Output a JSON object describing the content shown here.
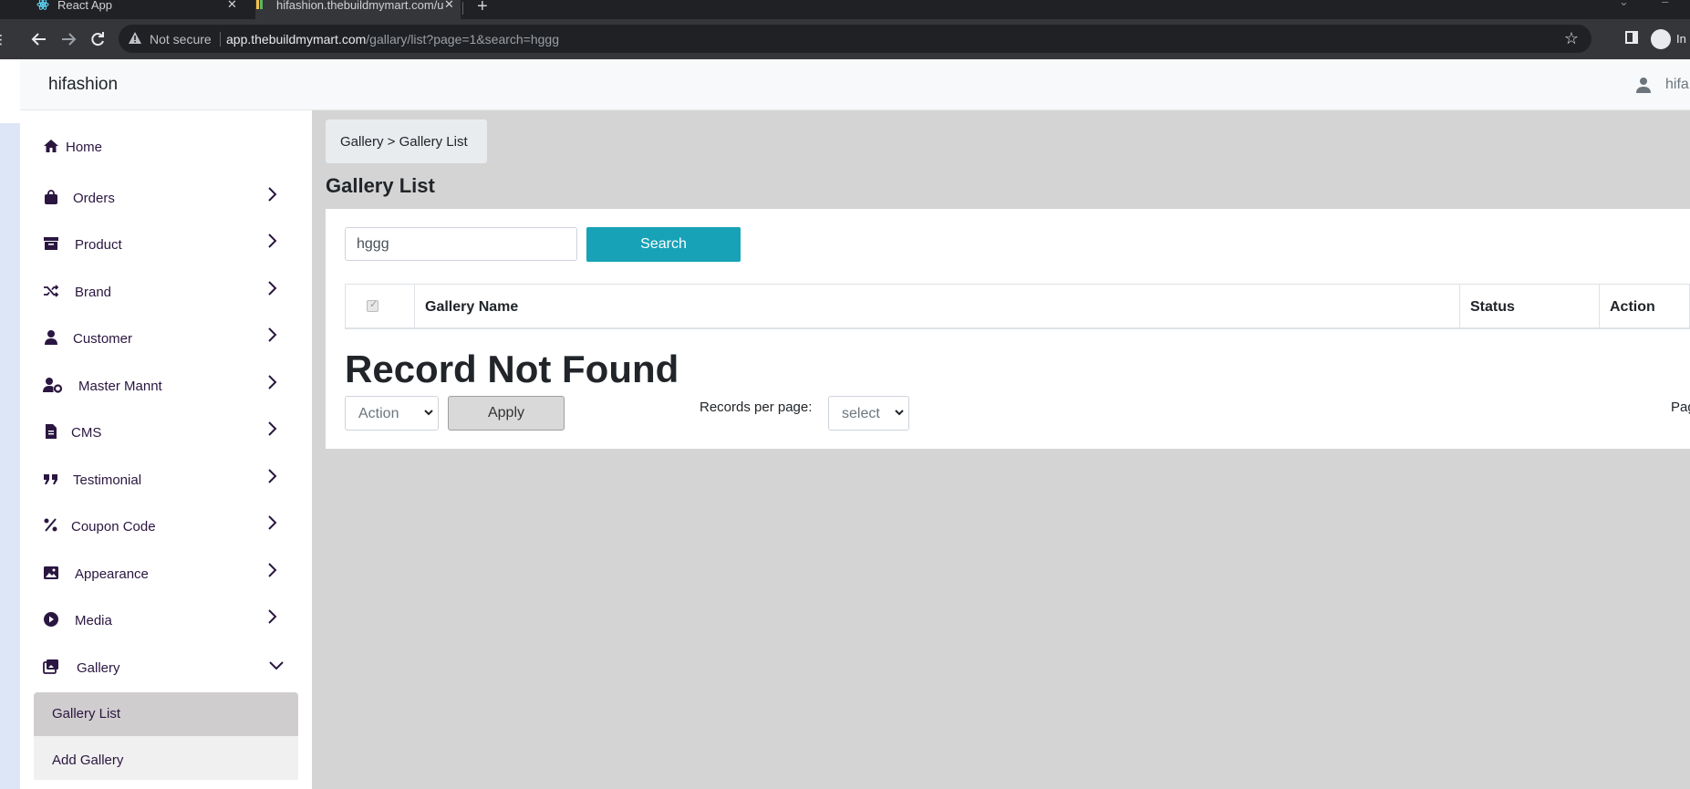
{
  "browser": {
    "tabs": [
      {
        "title": "React App",
        "close": "✕"
      },
      {
        "title": "hifashion.thebuildmymart.com/u",
        "close": "✕"
      }
    ],
    "new_tab": "+",
    "url_warning": "Not secure",
    "url_host": "app.thebuildmymart.com",
    "url_path": "/gallary/list?page=1&search=hggg",
    "profile_text": "In"
  },
  "header": {
    "brand": "hifashion",
    "user_name": "hifa"
  },
  "sidebar": {
    "items": [
      {
        "label": "Home",
        "icon": "home-icon"
      },
      {
        "label": "Orders",
        "icon": "shopping-bag-icon"
      },
      {
        "label": "Product",
        "icon": "archive-box-icon"
      },
      {
        "label": "Brand",
        "icon": "shuffle-icon"
      },
      {
        "label": "Customer",
        "icon": "user-icon"
      },
      {
        "label": "Master Mannt",
        "icon": "user-gear-icon"
      },
      {
        "label": "CMS",
        "icon": "file-icon"
      },
      {
        "label": "Testimonial",
        "icon": "quote-icon"
      },
      {
        "label": "Coupon Code",
        "icon": "percent-icon"
      },
      {
        "label": "Appearance",
        "icon": "image-icon"
      },
      {
        "label": "Media",
        "icon": "play-circle-icon"
      },
      {
        "label": "Gallery",
        "icon": "images-icon"
      }
    ],
    "gallery_submenu": [
      {
        "label": "Gallery List",
        "active": true
      },
      {
        "label": "Add Gallery",
        "active": false
      }
    ]
  },
  "main": {
    "breadcrumb": "Gallery > Gallery List",
    "title": "Gallery List",
    "search_value": "hggg",
    "search_button": "Search",
    "table_headers": [
      "Gallery Name",
      "Status",
      "Action"
    ],
    "empty_message": "Record Not Found",
    "bulk_action": "Action",
    "apply_button": "Apply",
    "records_per_page_label": "Records per page:",
    "records_per_page_value": "select",
    "page_label": "Pag"
  },
  "colors": {
    "accent": "#17a2b8",
    "sidebar_text": "#2a1640",
    "content_bg": "#d4d4d4"
  }
}
